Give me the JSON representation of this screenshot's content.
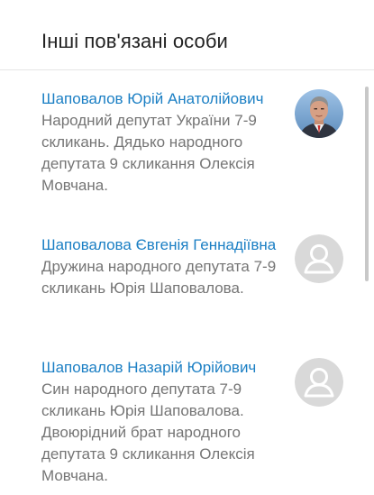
{
  "header": {
    "title": "Інші пов'язані особи"
  },
  "people": [
    {
      "name": "Шаповалов Юрій Анатолійович",
      "description": "Народний депутат України 7-9 скликань. Дядько народного депутата 9 скликання Олексія Мовчана.",
      "avatar": "photo"
    },
    {
      "name": "Шаповалова Євгенія Геннадіївна",
      "description": "Дружина народного депутата 7-9 скликань Юрія Шаповалова.",
      "avatar": "placeholder-user-icon"
    },
    {
      "name": "Шаповалов Назарій Юрійович",
      "description": "Син народного депутата 7-9 скликань Юрія Шаповалова. Двоюрідний брат народного депутата 9 скликання Олексія Мовчана.",
      "avatar": "placeholder-user-icon"
    }
  ],
  "colors": {
    "link": "#1b7fc4",
    "text_muted": "#757575",
    "placeholder_bg": "#d9d9d9",
    "divider": "#e6e6e6"
  }
}
